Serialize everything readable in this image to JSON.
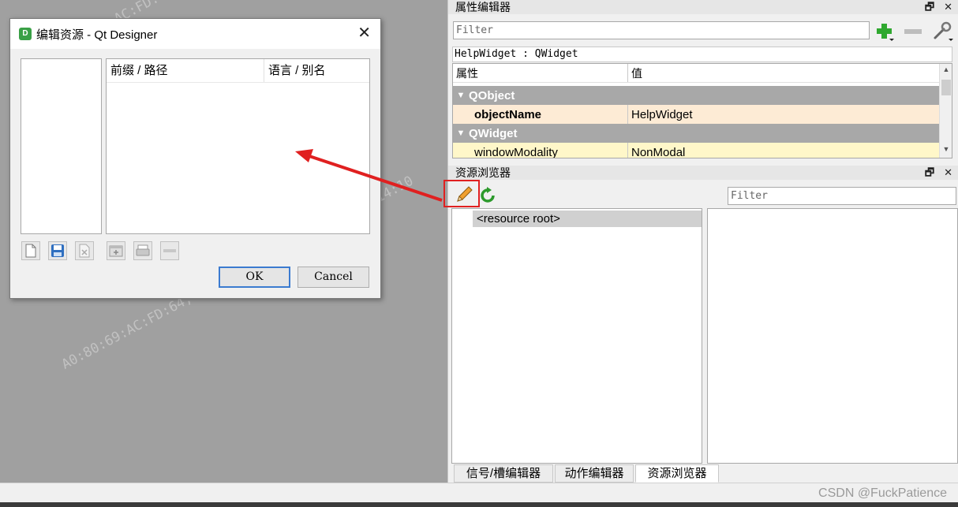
{
  "dialog": {
    "title": "编辑资源 - Qt Designer",
    "app_icon_letter": "D",
    "close_glyph": "✕",
    "table_headers": [
      "前缀 / 路径",
      "语言 / 别名"
    ],
    "ok_label": "OK",
    "cancel_label": "Cancel",
    "toolbar_icons": [
      "new-file-icon",
      "save-file-icon",
      "remove-file-icon",
      "add-prefix-icon",
      "add-files-icon",
      "remove-icon"
    ]
  },
  "property_editor": {
    "title": "属性编辑器",
    "filter_placeholder": "Filter",
    "object_class": "HelpWidget : QWidget",
    "headers": {
      "property": "属性",
      "value": "值"
    },
    "rows": [
      {
        "type": "group",
        "name": "QObject"
      },
      {
        "type": "prop",
        "name": "objectName",
        "value": "HelpWidget"
      },
      {
        "type": "group",
        "name": "QWidget"
      },
      {
        "type": "prop",
        "name": "windowModality",
        "value": "NonModal"
      }
    ],
    "float_glyph": "🗗",
    "close_glyph": "✕"
  },
  "resource_browser": {
    "title": "资源浏览器",
    "filter_placeholder": "Filter",
    "tree_root": "<resource root>",
    "float_glyph": "🗗",
    "close_glyph": "✕"
  },
  "bottom_tabs": [
    "信号/槽编辑器",
    "动作编辑器",
    "资源浏览器"
  ],
  "active_tab": "资源浏览器",
  "watermark": "A0:80:69:AC:FD:64, 10.10.41.38, 2024-04-22, 14:10",
  "credit": "CSDN @FuckPatience",
  "colors": {
    "annotation_red": "#e02020",
    "group_row": "#a8a8a8",
    "object_name_row": "#fdebd5",
    "modality_row": "#fff7c9",
    "add_icon_green": "#2fa82f"
  }
}
